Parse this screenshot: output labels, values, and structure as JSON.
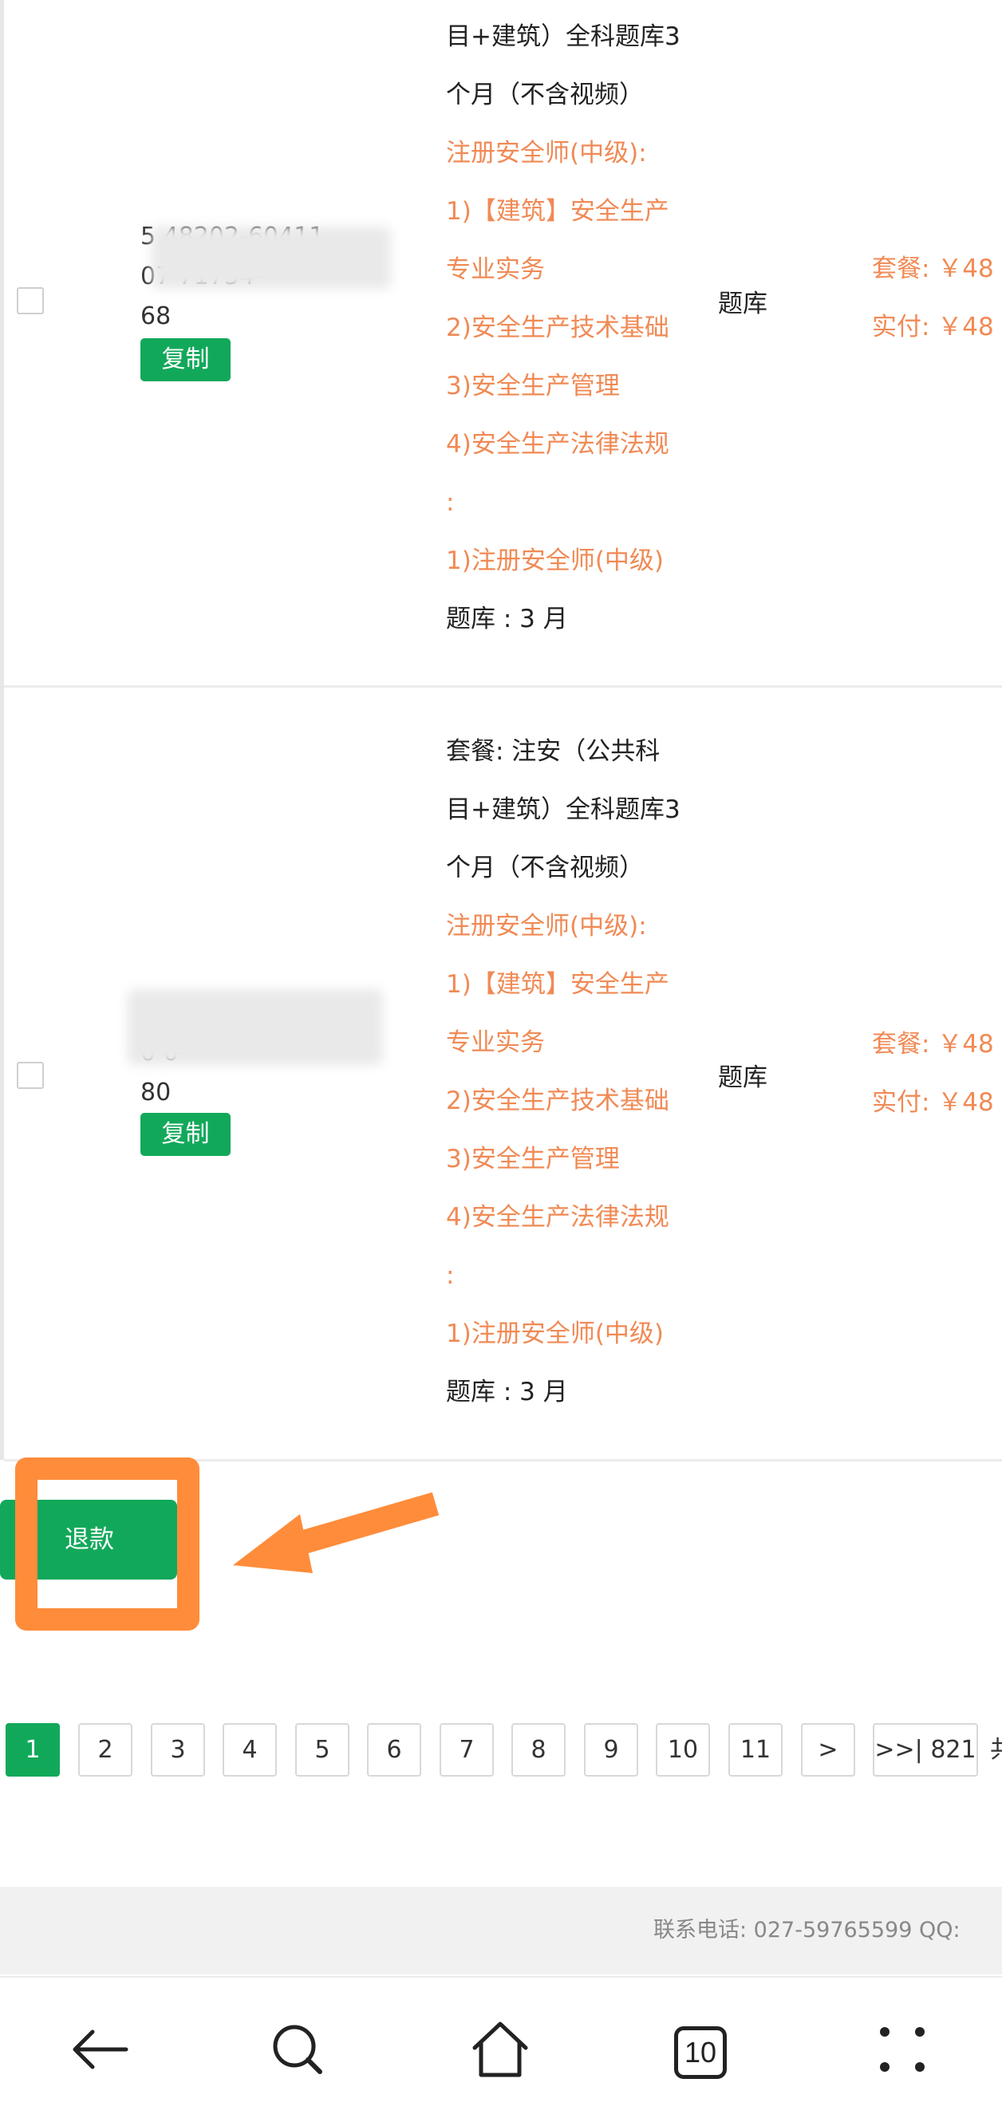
{
  "orders": [
    {
      "order_number": "5…48202-60411-07…71754-68",
      "order_lines": [
        "5      48202-60411",
        "07              71754-",
        "68"
      ],
      "copy_label": "复制",
      "package_lines": [
        {
          "text": "目+建筑）全科题库3",
          "color": "dark"
        },
        {
          "text": "个月（不含视频）",
          "color": "dark"
        },
        {
          "text": "注册安全师(中级):",
          "color": "orange"
        },
        {
          "text": "1)【建筑】安全生产",
          "color": "orange"
        },
        {
          "text": "专业实务",
          "color": "orange"
        },
        {
          "text": "2)安全生产技术基础",
          "color": "orange"
        },
        {
          "text": "3)安全生产管理",
          "color": "orange"
        },
        {
          "text": "4)安全生产法律法规",
          "color": "orange"
        },
        {
          "text": ":",
          "color": "orange"
        },
        {
          "text": "1)注册安全师(中级)",
          "color": "orange"
        },
        {
          "text": "题库 : 3 月",
          "color": "dark"
        }
      ],
      "type": "题库",
      "price_package": "套餐: ￥48",
      "price_paid": "实付: ￥48"
    },
    {
      "order_number": "…-0…-80",
      "order_lines": [
        "                              -",
        "0                                0-",
        "80"
      ],
      "copy_label": "复制",
      "package_lines": [
        {
          "text": "套餐: 注安（公共科",
          "color": "dark"
        },
        {
          "text": "目+建筑）全科题库3",
          "color": "dark"
        },
        {
          "text": "个月（不含视频）",
          "color": "dark"
        },
        {
          "text": "注册安全师(中级):",
          "color": "orange"
        },
        {
          "text": "1)【建筑】安全生产",
          "color": "orange"
        },
        {
          "text": "专业实务",
          "color": "orange"
        },
        {
          "text": "2)安全生产技术基础",
          "color": "orange"
        },
        {
          "text": "3)安全生产管理",
          "color": "orange"
        },
        {
          "text": "4)安全生产法律法规",
          "color": "orange"
        },
        {
          "text": ":",
          "color": "orange"
        },
        {
          "text": "1)注册安全师(中级)",
          "color": "orange"
        },
        {
          "text": "题库 : 3 月",
          "color": "dark"
        }
      ],
      "type": "题库",
      "price_package": "套餐: ￥48",
      "price_paid": "实付: ￥48"
    }
  ],
  "refund_label": "退款",
  "pagination": {
    "pages": [
      "1",
      "2",
      "3",
      "4",
      "5",
      "6",
      "7",
      "8",
      "9",
      "10",
      "11"
    ],
    "current": "1",
    "next": ">",
    "last": ">>| 821",
    "trailing": "共"
  },
  "footer": {
    "text": "联系电话: 027-59765599   QQ:"
  },
  "navbar": {
    "tab_count": "10"
  },
  "colors": {
    "accent_green": "#12a85a",
    "orange_text": "#f08a55",
    "highlight": "#ff8c3a"
  }
}
